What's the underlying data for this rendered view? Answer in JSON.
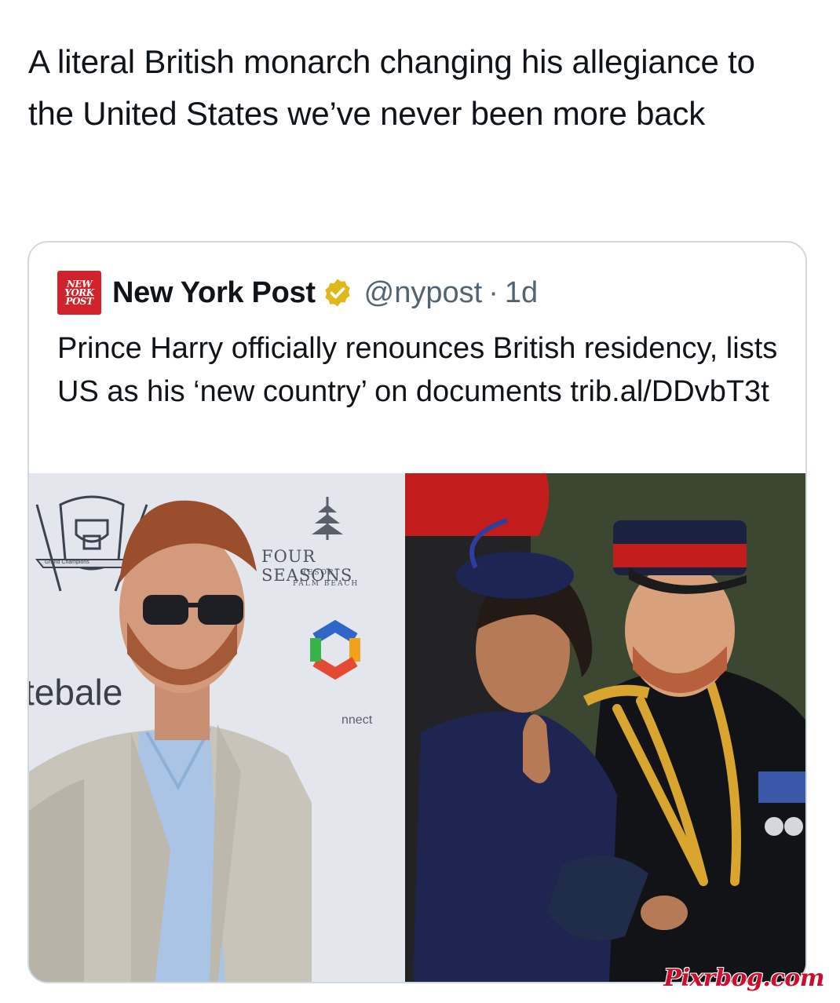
{
  "tweet": {
    "text": "A literal British monarch changing his allegiance to the United States we’ve never been more back"
  },
  "quoted_tweet": {
    "logo_text": [
      "NEW",
      "YORK",
      "POST"
    ],
    "author_name": "New York Post",
    "verified": true,
    "handle": "@nypost",
    "separator": "·",
    "time": "1d",
    "body": "Prince Harry officially renounces British residency, lists US as his ‘new country’ on documents trib.al/DDvbT3t",
    "media": {
      "left_photo": {
        "backdrop_brand": "FOUR SEASONS",
        "backdrop_sub1": "RESORT",
        "backdrop_sub2": "PALM BEACH",
        "backdrop_left_text": "tebale",
        "backdrop_connect_text": "nnect",
        "crest_text": "Grand Champions"
      }
    }
  },
  "watermark": "Pixrbog.com",
  "colors": {
    "nyp_red": "#d2232a",
    "verified_gold": "#e2b719",
    "secondary_text": "#536471",
    "border": "#cfd9de",
    "watermark": "#c8102e"
  }
}
